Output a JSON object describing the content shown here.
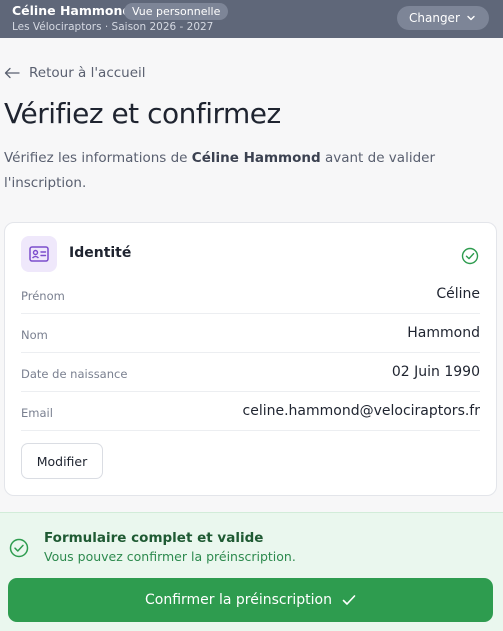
{
  "header": {
    "user_name": "Céline Hammond",
    "badge": "Vue personnelle",
    "subtitle": "Les Vélociraptors · Saison 2026 - 2027",
    "switch_label": "Changer"
  },
  "nav": {
    "back_label": "Retour à l'accueil"
  },
  "page": {
    "title": "Vérifiez et confirmez",
    "intro_before": "Vérifiez les informations de ",
    "intro_name": "Céline Hammond",
    "intro_after": " avant de valider l'inscription."
  },
  "identity": {
    "title": "Identité",
    "fields": [
      {
        "label": "Prénom",
        "value": "Céline"
      },
      {
        "label": "Nom",
        "value": "Hammond"
      },
      {
        "label": "Date de naissance",
        "value": "02 Juin 1990"
      },
      {
        "label": "Email",
        "value": "celine.hammond@velociraptors.fr"
      }
    ],
    "edit_label": "Modifier"
  },
  "status": {
    "title": "Formulaire complet et valide",
    "message": "Vous pouvez confirmer la préinscription."
  },
  "confirm_label": "Confirmer la préinscription",
  "colors": {
    "header_bg": "#5f6779",
    "accent_purple": "#7c4dcc",
    "success_green": "#2e9c4f",
    "success_bg": "#eaf7ee"
  },
  "icons": [
    "chevron-down-icon",
    "arrow-left-icon",
    "id-card-icon",
    "check-circle-icon",
    "check-icon"
  ]
}
